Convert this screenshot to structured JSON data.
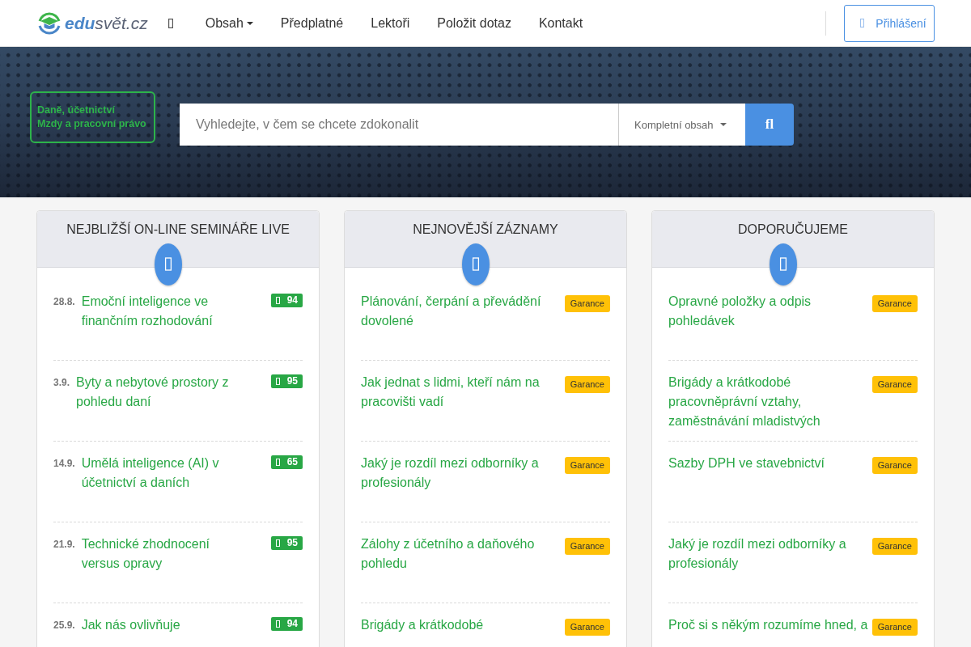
{
  "header": {
    "logo": "**edu**svět.cz",
    "nav": [
      {
        "kind": "icon"
      },
      {
        "kind": "dropdown",
        "label": "Obsah"
      },
      {
        "kind": "link",
        "label": "Předplatné"
      },
      {
        "kind": "link",
        "label": "Lektoři"
      },
      {
        "kind": "link",
        "label": "Položit dotaz"
      },
      {
        "kind": "link",
        "label": "Kontakt"
      }
    ],
    "login_button": {
      "label": "Přihlášení"
    }
  },
  "hero": {
    "category_box": {
      "lines": [
        "Daně, účetnictví",
        "Mzdy a pracovní právo"
      ]
    },
    "search": {
      "placeholder": "Vyhledejte, v čem se chcete zdokonalit",
      "scope": "Kompletní obsah",
      "button": "fl"
    }
  },
  "sections": [
    {
      "title": "NEJBLIŽŠÍ ON-LINE SEMINÁŘE LIVE",
      "items": [
        {
          "date": "28.8.",
          "title": "Emoční inteligence ve finančním rozhodování",
          "badge": {
            "kind": "score",
            "text": "94"
          }
        },
        {
          "date": "3.9.",
          "title": "Byty a nebytové prostory z pohledu daní",
          "badge": {
            "kind": "score",
            "text": "95"
          }
        },
        {
          "date": "14.9.",
          "title": "Umělá inteligence (AI) v účetnictví a daních",
          "badge": {
            "kind": "score",
            "text": "65"
          }
        },
        {
          "date": "21.9.",
          "title": "Technické zhodnocení versus opravy",
          "badge": {
            "kind": "score",
            "text": "95"
          }
        },
        {
          "date": "25.9.",
          "title": "Jak nás ovlivňuje",
          "badge": {
            "kind": "score",
            "text": "94"
          }
        }
      ]
    },
    {
      "title": "NEJNOVĚJŠÍ ZÁZNAMY",
      "items": [
        {
          "title": "Plánování, čerpání a převádění dovolené",
          "badge": {
            "kind": "guarantee",
            "text": "Garance"
          }
        },
        {
          "title": "Jak jednat s lidmi, kteří nám na pracovišti vadí",
          "badge": {
            "kind": "guarantee",
            "text": "Garance"
          }
        },
        {
          "title": "Jaký je rozdíl mezi odborníky a profesionály",
          "badge": {
            "kind": "guarantee",
            "text": "Garance"
          }
        },
        {
          "title": "Zálohy z účetního a daňového pohledu",
          "badge": {
            "kind": "guarantee",
            "text": "Garance"
          }
        },
        {
          "title": "Brigády a krátkodobé",
          "badge": {
            "kind": "guarantee",
            "text": "Garance"
          }
        }
      ]
    },
    {
      "title": "DOPORUČUJEME",
      "items": [
        {
          "title": "Opravné položky a odpis pohledávek",
          "badge": {
            "kind": "guarantee",
            "text": "Garance"
          }
        },
        {
          "title": "Brigády a krátkodobé pracovněprávní vztahy, zaměstnávání mladistvých",
          "badge": {
            "kind": "guarantee",
            "text": "Garance"
          }
        },
        {
          "title": "Sazby DPH ve stavebnictví",
          "badge": {
            "kind": "guarantee",
            "text": "Garance"
          }
        },
        {
          "title": "Jaký je rozdíl mezi odborníky a profesionály",
          "badge": {
            "kind": "guarantee",
            "text": "Garance"
          }
        },
        {
          "title": "Proč si s někým rozumíme hned, a",
          "badge": {
            "kind": "guarantee",
            "text": "Garance"
          }
        }
      ]
    }
  ]
}
